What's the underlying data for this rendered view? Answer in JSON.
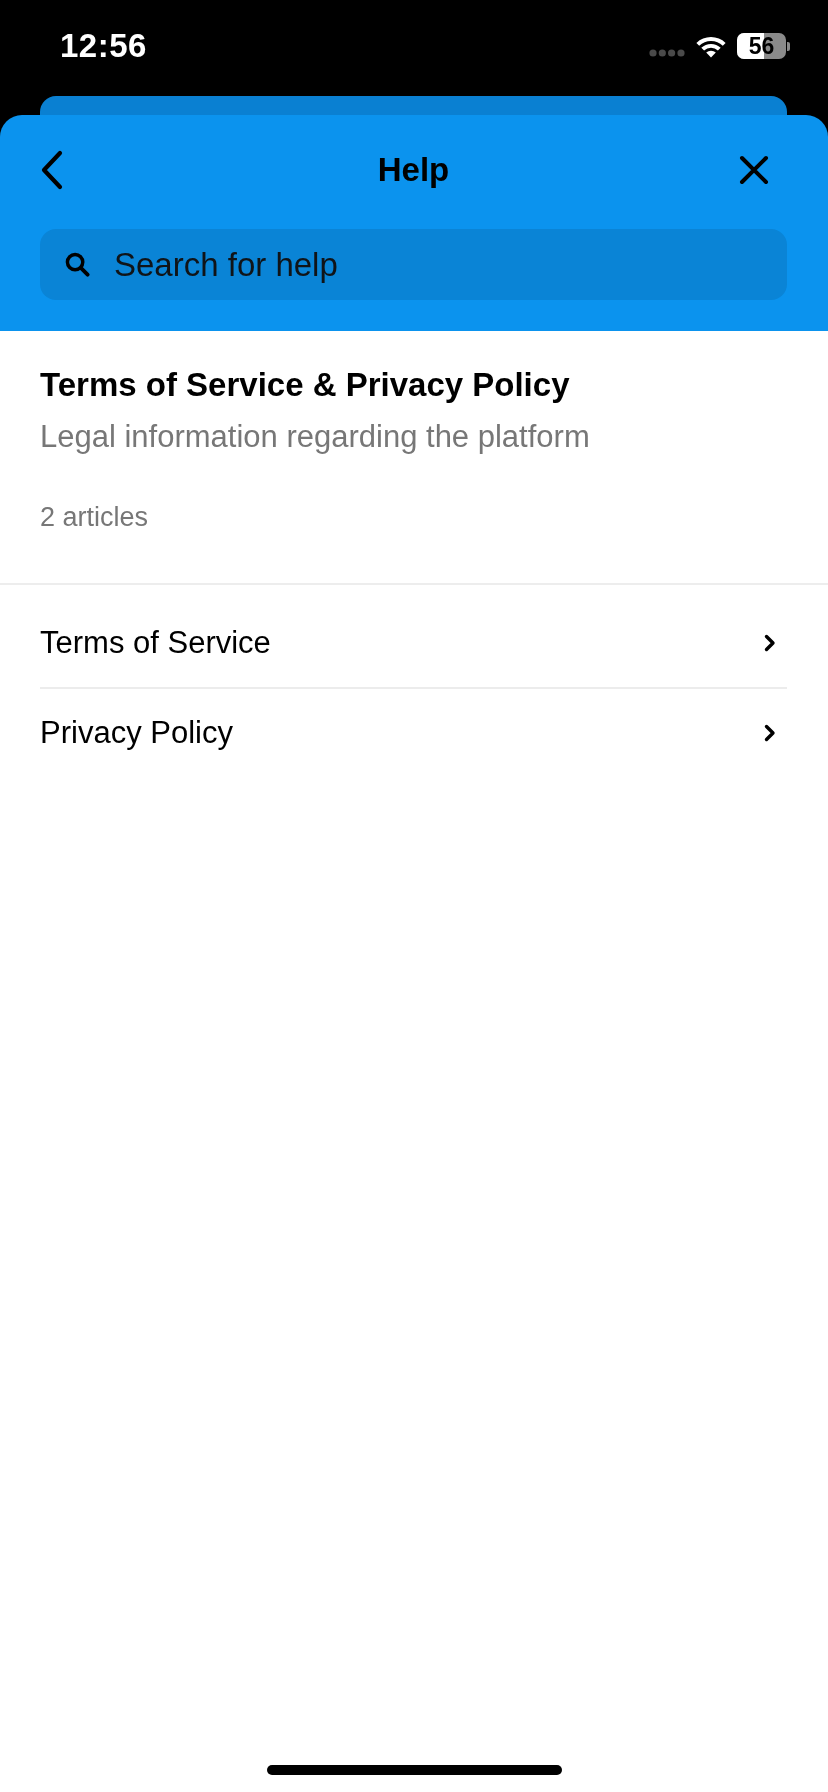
{
  "status_bar": {
    "time": "12:56",
    "battery": "56"
  },
  "header": {
    "title": "Help"
  },
  "search": {
    "placeholder": "Search for help"
  },
  "collection": {
    "title": "Terms of Service & Privacy Policy",
    "description": "Legal information regarding the platform",
    "article_count": "2 articles"
  },
  "articles": [
    {
      "title": "Terms of Service"
    },
    {
      "title": "Privacy Policy"
    }
  ]
}
